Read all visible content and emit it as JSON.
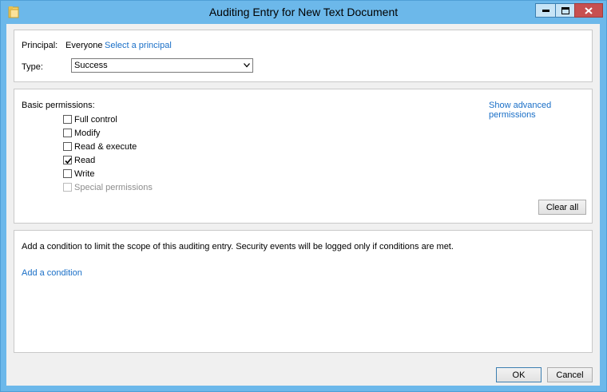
{
  "window": {
    "title": "Auditing Entry for New Text Document"
  },
  "principal": {
    "label": "Principal:",
    "value": "Everyone",
    "select_link": "Select a principal"
  },
  "type": {
    "label": "Type:",
    "selected": "Success"
  },
  "permissions": {
    "label": "Basic permissions:",
    "advanced_link": "Show advanced permissions",
    "items": [
      {
        "label": "Full control",
        "checked": false,
        "enabled": true
      },
      {
        "label": "Modify",
        "checked": false,
        "enabled": true
      },
      {
        "label": "Read & execute",
        "checked": false,
        "enabled": true
      },
      {
        "label": "Read",
        "checked": true,
        "enabled": true
      },
      {
        "label": "Write",
        "checked": false,
        "enabled": true
      },
      {
        "label": "Special permissions",
        "checked": false,
        "enabled": false
      }
    ],
    "clear_all": "Clear all"
  },
  "condition": {
    "description": "Add a condition to limit the scope of this auditing entry. Security events will be logged only if conditions are met.",
    "add_link": "Add a condition"
  },
  "footer": {
    "ok": "OK",
    "cancel": "Cancel"
  }
}
